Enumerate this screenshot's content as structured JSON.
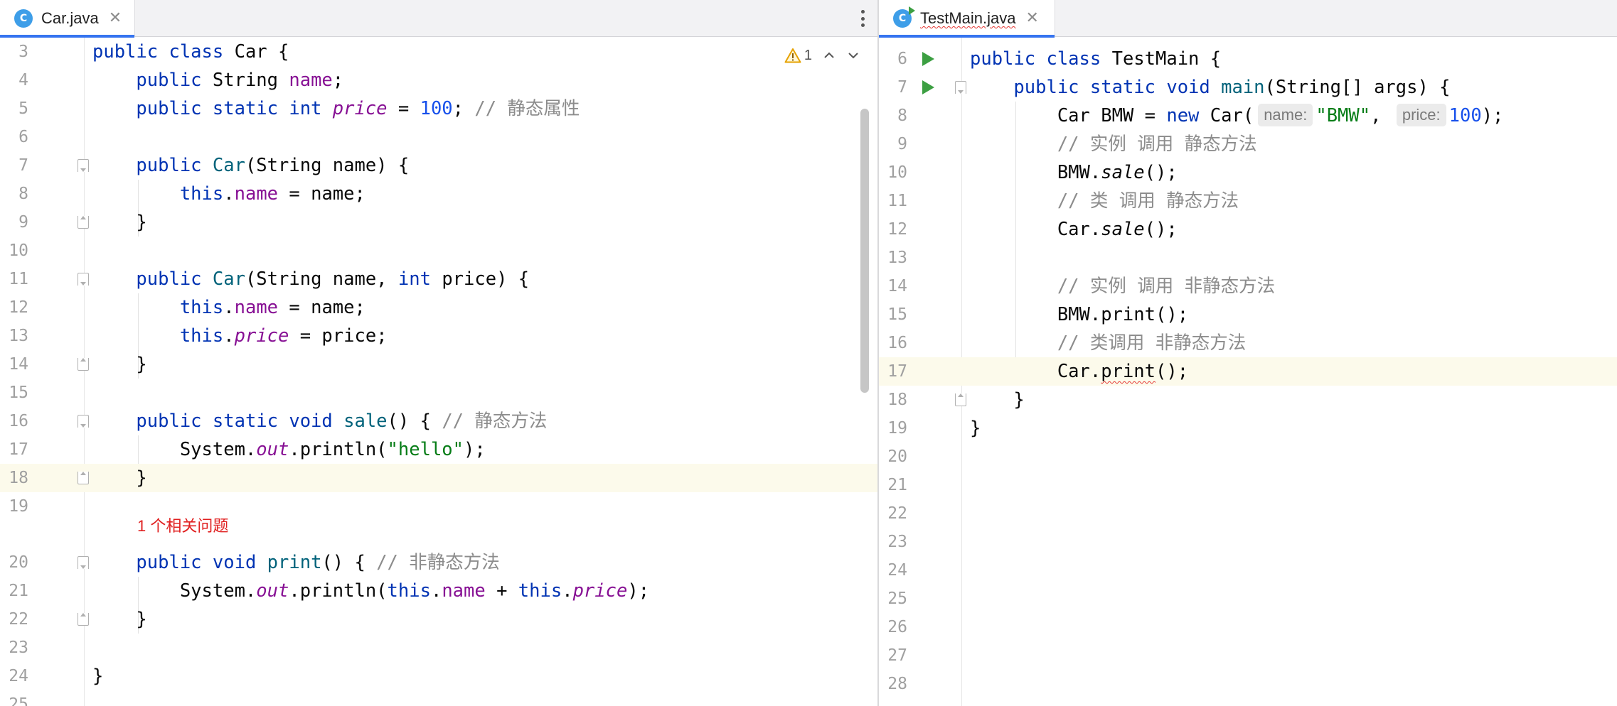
{
  "left_editor": {
    "tab": {
      "icon": "class-c-icon",
      "icon_letter": "C",
      "label": "Car.java",
      "close": "✕"
    },
    "inspection": {
      "warning_count": "1"
    },
    "problem_hint": "1 个相关问题",
    "lines": [
      {
        "num": "3",
        "tokens": [
          [
            "k",
            "public "
          ],
          [
            "k",
            "class "
          ],
          [
            "",
            "Car {"
          ]
        ]
      },
      {
        "num": "4",
        "tokens": [
          [
            "",
            "    "
          ],
          [
            "k",
            "public "
          ],
          [
            "",
            "String "
          ],
          [
            "f",
            "name"
          ],
          [
            "",
            ";"
          ]
        ]
      },
      {
        "num": "5",
        "tokens": [
          [
            "",
            "    "
          ],
          [
            "k",
            "public static int "
          ],
          [
            "fi",
            "price"
          ],
          [
            "",
            " = "
          ],
          [
            "n",
            "100"
          ],
          [
            "",
            "; "
          ],
          [
            "c",
            "// 静态属性"
          ]
        ]
      },
      {
        "num": "6",
        "tokens": []
      },
      {
        "num": "7",
        "tokens": [
          [
            "",
            "    "
          ],
          [
            "k",
            "public "
          ],
          [
            "m",
            "Car"
          ],
          [
            "",
            "(String name) {"
          ]
        ]
      },
      {
        "num": "8",
        "tokens": [
          [
            "",
            "        "
          ],
          [
            "k",
            "this"
          ],
          [
            "",
            "."
          ],
          [
            "f",
            "name"
          ],
          [
            "",
            " = name;"
          ]
        ]
      },
      {
        "num": "9",
        "tokens": [
          [
            "",
            "    }"
          ]
        ]
      },
      {
        "num": "10",
        "tokens": []
      },
      {
        "num": "11",
        "tokens": [
          [
            "",
            "    "
          ],
          [
            "k",
            "public "
          ],
          [
            "m",
            "Car"
          ],
          [
            "",
            "(String name, "
          ],
          [
            "k",
            "int "
          ],
          [
            "",
            "price) {"
          ]
        ]
      },
      {
        "num": "12",
        "tokens": [
          [
            "",
            "        "
          ],
          [
            "k",
            "this"
          ],
          [
            "",
            "."
          ],
          [
            "f",
            "name"
          ],
          [
            "",
            " = name;"
          ]
        ]
      },
      {
        "num": "13",
        "tokens": [
          [
            "",
            "        "
          ],
          [
            "k",
            "this"
          ],
          [
            "",
            "."
          ],
          [
            "fi",
            "price"
          ],
          [
            "",
            " = price;"
          ]
        ]
      },
      {
        "num": "14",
        "tokens": [
          [
            "",
            "    }"
          ]
        ]
      },
      {
        "num": "15",
        "tokens": []
      },
      {
        "num": "16",
        "tokens": [
          [
            "",
            "    "
          ],
          [
            "k",
            "public static void "
          ],
          [
            "m",
            "sale"
          ],
          [
            "",
            "() { "
          ],
          [
            "c",
            "// 静态方法"
          ]
        ]
      },
      {
        "num": "17",
        "tokens": [
          [
            "",
            "        System."
          ],
          [
            "fi",
            "out"
          ],
          [
            "",
            ".println("
          ],
          [
            "s",
            "\"hello\""
          ],
          [
            "",
            ");"
          ]
        ]
      },
      {
        "num": "18",
        "tokens": [
          [
            "",
            "    }"
          ]
        ]
      },
      {
        "num": "19",
        "tokens": []
      },
      {
        "num": "20",
        "tokens": [
          [
            "",
            "    "
          ],
          [
            "k",
            "public void "
          ],
          [
            "m",
            "print"
          ],
          [
            "",
            "() { "
          ],
          [
            "c",
            "// 非静态方法"
          ]
        ]
      },
      {
        "num": "21",
        "tokens": [
          [
            "",
            "        System."
          ],
          [
            "fi",
            "out"
          ],
          [
            "",
            ".println("
          ],
          [
            "k",
            "this"
          ],
          [
            "",
            "."
          ],
          [
            "f",
            "name"
          ],
          [
            "",
            " + "
          ],
          [
            "k",
            "this"
          ],
          [
            "",
            "."
          ],
          [
            "fi",
            "price"
          ],
          [
            "",
            ");"
          ]
        ]
      },
      {
        "num": "22",
        "tokens": [
          [
            "",
            "    }"
          ]
        ]
      },
      {
        "num": "23",
        "tokens": []
      },
      {
        "num": "24",
        "tokens": [
          [
            "",
            "}"
          ]
        ]
      },
      {
        "num": "25",
        "tokens": []
      }
    ]
  },
  "right_editor": {
    "tab": {
      "icon": "runnable-class-icon",
      "icon_letter": "C",
      "label": "TestMain.java",
      "close": "✕"
    },
    "lines": [
      {
        "num": "6",
        "tokens": [
          [
            "k",
            "public class "
          ],
          [
            "",
            "TestMain {"
          ]
        ]
      },
      {
        "num": "7",
        "tokens": [
          [
            "",
            "    "
          ],
          [
            "k",
            "public static void "
          ],
          [
            "m",
            "main"
          ],
          [
            "",
            "(String[] args) {"
          ]
        ]
      },
      {
        "num": "8",
        "tokens": [
          [
            "",
            "        Car BMW = "
          ],
          [
            "k",
            "new "
          ],
          [
            "",
            "Car("
          ],
          [
            "hint",
            "name:"
          ],
          [
            "s",
            "\"BMW\""
          ],
          [
            "",
            ", "
          ],
          [
            "hint",
            "price:"
          ],
          [
            "n",
            "100"
          ],
          [
            "",
            ");"
          ]
        ]
      },
      {
        "num": "9",
        "tokens": [
          [
            "",
            "        "
          ],
          [
            "c",
            "// 实例 调用 静态方法"
          ]
        ]
      },
      {
        "num": "10",
        "tokens": [
          [
            "",
            "        BMW."
          ],
          [
            "mi",
            "sale"
          ],
          [
            "",
            "();"
          ]
        ]
      },
      {
        "num": "11",
        "tokens": [
          [
            "",
            "        "
          ],
          [
            "c",
            "// 类 调用 静态方法"
          ]
        ]
      },
      {
        "num": "12",
        "tokens": [
          [
            "",
            "        Car."
          ],
          [
            "mi",
            "sale"
          ],
          [
            "",
            "();"
          ]
        ]
      },
      {
        "num": "13",
        "tokens": []
      },
      {
        "num": "14",
        "tokens": [
          [
            "",
            "        "
          ],
          [
            "c",
            "// 实例 调用 非静态方法"
          ]
        ]
      },
      {
        "num": "15",
        "tokens": [
          [
            "",
            "        BMW.print();"
          ]
        ]
      },
      {
        "num": "16",
        "tokens": [
          [
            "",
            "        "
          ],
          [
            "c",
            "// 类调用 非静态方法"
          ]
        ]
      },
      {
        "num": "17",
        "tokens": [
          [
            "",
            "        Car."
          ],
          [
            "err",
            "print"
          ],
          [
            "",
            "();"
          ]
        ]
      },
      {
        "num": "18",
        "tokens": [
          [
            "",
            "    }"
          ]
        ]
      },
      {
        "num": "19",
        "tokens": [
          [
            "",
            "}"
          ]
        ]
      },
      {
        "num": "20",
        "tokens": []
      },
      {
        "num": "21",
        "tokens": []
      },
      {
        "num": "22",
        "tokens": []
      },
      {
        "num": "23",
        "tokens": []
      },
      {
        "num": "24",
        "tokens": []
      },
      {
        "num": "25",
        "tokens": []
      },
      {
        "num": "26",
        "tokens": []
      },
      {
        "num": "27",
        "tokens": []
      },
      {
        "num": "28",
        "tokens": []
      }
    ]
  },
  "colors": {
    "keyword": "#0033b3",
    "field": "#871094",
    "method_decl": "#00627a",
    "string": "#067d17",
    "number": "#1750eb",
    "comment": "#8c8c8c",
    "error": "#e02020",
    "current_line": "#fcfaeb",
    "accent": "#3574f0",
    "run": "#3c9f42"
  }
}
